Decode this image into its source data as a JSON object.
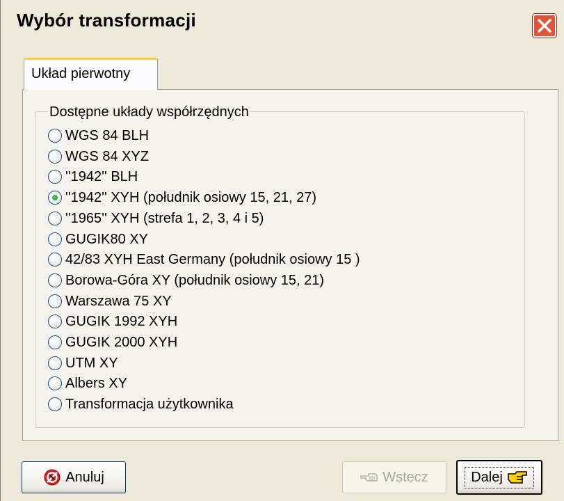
{
  "window": {
    "title": "Wybór transformacji",
    "close_icon": "close-icon"
  },
  "tabs": [
    {
      "label": "Układ pierwotny",
      "selected": true
    }
  ],
  "group": {
    "title": "Dostępne układy współrzędnych",
    "options": [
      {
        "label": "WGS 84 BLH",
        "checked": false
      },
      {
        "label": "WGS 84 XYZ",
        "checked": false
      },
      {
        "label": "''1942'' BLH",
        "checked": false
      },
      {
        "label": "''1942'' XYH (południk osiowy 15, 21, 27)",
        "checked": true
      },
      {
        "label": "''1965'' XYH (strefa 1, 2, 3, 4 i 5)",
        "checked": false
      },
      {
        "label": "GUGIK80 XY",
        "checked": false
      },
      {
        "label": "42/83 XYH East Germany (południk osiowy 15 )",
        "checked": false
      },
      {
        "label": "Borowa-Góra XY (południk osiowy 15, 21)",
        "checked": false
      },
      {
        "label": "Warszawa 75 XY",
        "checked": false
      },
      {
        "label": "GUGIK 1992 XYH",
        "checked": false
      },
      {
        "label": "GUGIK 2000 XYH",
        "checked": false
      },
      {
        "label": "UTM XY",
        "checked": false
      },
      {
        "label": "Albers XY",
        "checked": false
      },
      {
        "label": "Transformacja użytkownika",
        "checked": false
      }
    ]
  },
  "buttons": {
    "cancel": {
      "label": "Anuluj",
      "icon": "cancel-icon"
    },
    "back": {
      "label": "Wstecz",
      "icon": "hand-left-icon",
      "disabled": true
    },
    "next": {
      "label": "Dalej",
      "icon": "hand-right-icon"
    }
  },
  "colors": {
    "accent_tab": "#ffc83c",
    "close_red": "#e0553a",
    "radio_check": "#21a121"
  }
}
